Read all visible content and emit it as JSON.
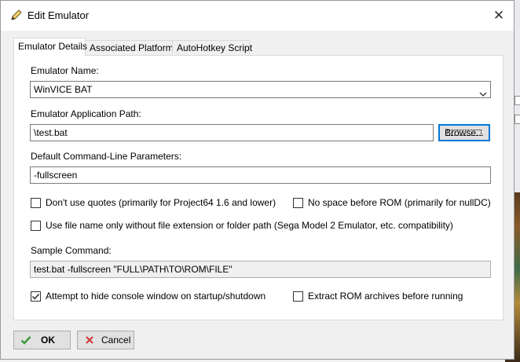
{
  "window": {
    "title": "Edit Emulator",
    "title_icon": "pencil-icon",
    "close_icon": "close-icon",
    "close_glyph": "✕"
  },
  "tabs": [
    {
      "label": "Emulator Details",
      "active": true
    },
    {
      "label": "Associated Platforms",
      "active": false
    },
    {
      "label": "AutoHotkey Script",
      "active": false
    }
  ],
  "form": {
    "emulator_name_label": "Emulator Name:",
    "emulator_name_value": "WinVICE BAT",
    "app_path_label": "Emulator Application Path:",
    "app_path_value": "\\test.bat",
    "browse_label": "Browse...",
    "params_label": "Default Command-Line Parameters:",
    "params_value": "-fullscreen",
    "checkboxes": [
      {
        "label": "Don't use quotes (primarily for Project64 1.6 and lower)",
        "checked": false
      },
      {
        "label": "No space before ROM (primarily for nullDC)",
        "checked": false
      },
      {
        "label": "Use file name only without file extension or folder path (Sega Model 2 Emulator, etc. compatibility)",
        "checked": false
      },
      {
        "label": "Attempt to hide console window on startup/shutdown",
        "checked": true
      },
      {
        "label": "Extract ROM archives before running",
        "checked": false
      }
    ],
    "sample_label": "Sample Command:",
    "sample_value": "test.bat -fullscreen \"FULL\\PATH\\TO\\ROM\\FILE\""
  },
  "buttons": {
    "ok_label": "OK",
    "cancel_label": "Cancel"
  },
  "colors": {
    "accent": "#0078d7",
    "ok_check": "#3a9a3a",
    "cancel_x": "#d23b3b"
  }
}
